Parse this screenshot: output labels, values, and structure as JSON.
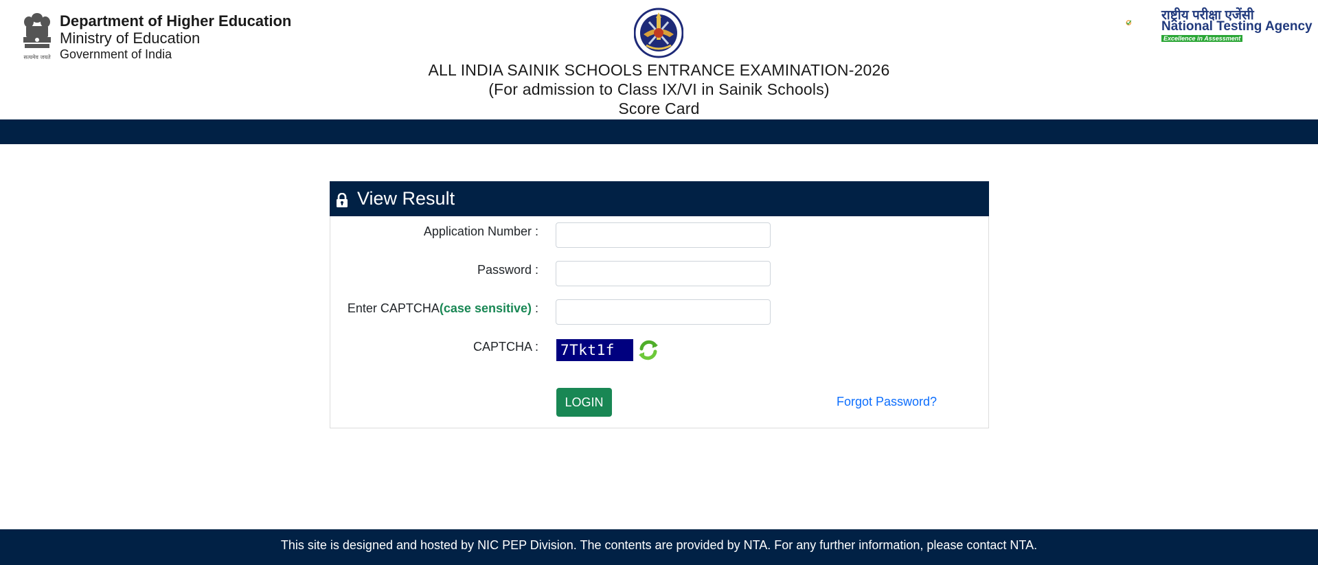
{
  "header": {
    "dept_line1": "Department of Higher Education",
    "dept_line2": "Ministry of Education",
    "dept_line3": "Government of India",
    "emblem_icon": "national-emblem-icon",
    "crest_icon": "sainik-school-crest-icon",
    "title_line1": "ALL INDIA SAINIK SCHOOLS ENTRANCE EXAMINATION-2026",
    "title_line2": "(For admission to Class IX/VI in Sainik Schools)",
    "title_line3": "Score Card",
    "nta_hindi": "राष्ट्रीय परीक्षा एजेंसी",
    "nta_english": "National Testing Agency",
    "nta_tagline": "Excellence in Assessment"
  },
  "card": {
    "title": "View Result",
    "title_icon": "lock-icon",
    "application_label": "Application Number :",
    "application_value": "",
    "password_label": "Password :",
    "password_value": "",
    "captcha_entry_label": "Enter CAPTCHA",
    "captcha_case_note": "(case sensitive)",
    "captcha_entry_suffix": " :",
    "captcha_entry_value": "",
    "captcha_label": "CAPTCHA :",
    "captcha_text": "7Tkt1f",
    "refresh_icon": "refresh-icon",
    "login_label": "LOGIN",
    "forgot_label": "Forgot Password?"
  },
  "footer": {
    "text": "This site is designed and hosted by NIC PEP Division. The contents are provided by NTA. For any further information, please contact NTA."
  },
  "colors": {
    "navy": "#012145",
    "login_green": "#198754",
    "link_blue": "#0d6efd",
    "captcha_bg": "#00007f"
  }
}
